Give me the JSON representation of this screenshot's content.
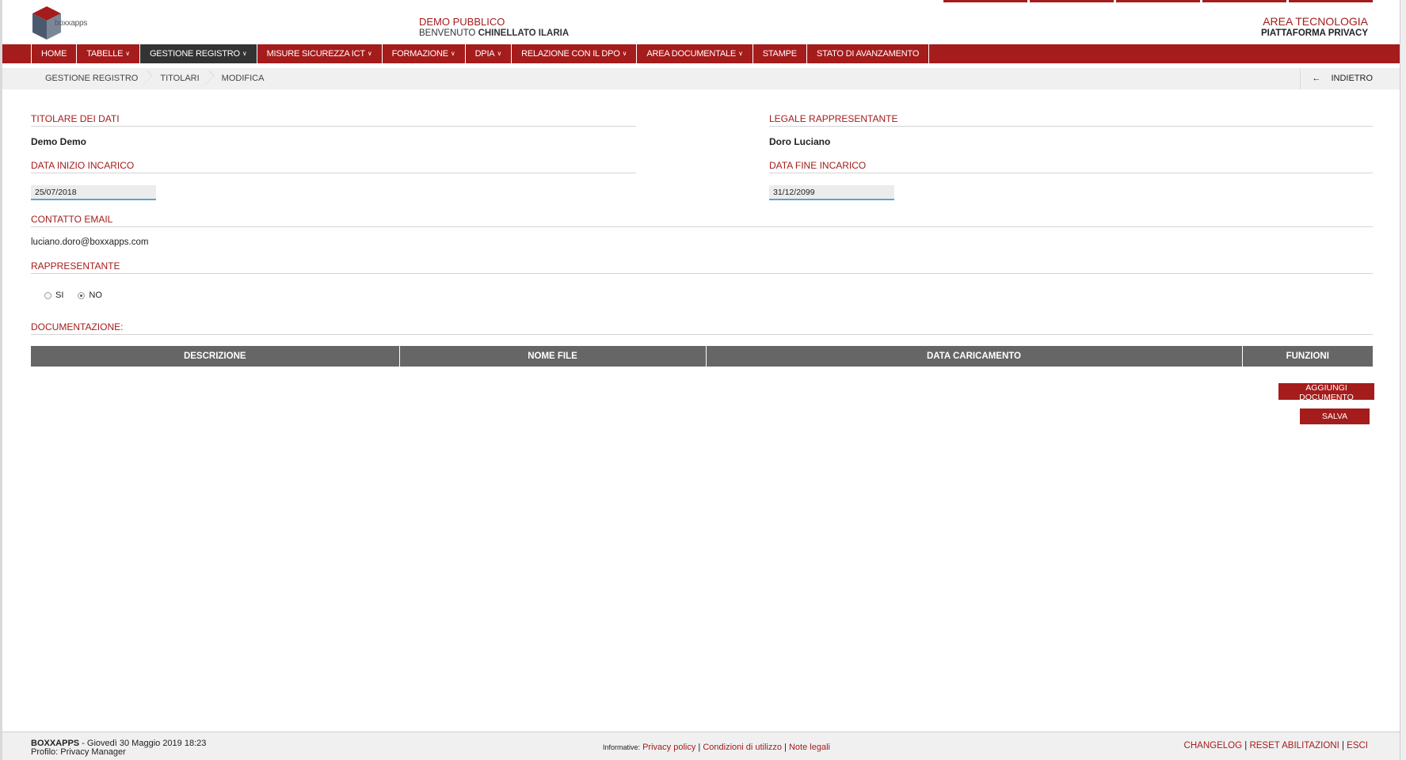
{
  "brand": {
    "logo_label": "boxxapps"
  },
  "header": {
    "demo": "DEMO PUBBLICO",
    "welcome_prefix": "BENVENUTO",
    "user": "CHINELLATO ILARIA",
    "area": "AREA TECNOLOGIA",
    "platform": "PIATTAFORMA PRIVACY"
  },
  "nav": [
    {
      "label": "HOME",
      "dropdown": false
    },
    {
      "label": "TABELLE",
      "dropdown": true
    },
    {
      "label": "GESTIONE REGISTRO",
      "dropdown": true,
      "active": true
    },
    {
      "label": "MISURE SICUREZZA ICT",
      "dropdown": true
    },
    {
      "label": "FORMAZIONE",
      "dropdown": true
    },
    {
      "label": "DPIA",
      "dropdown": true
    },
    {
      "label": "RELAZIONE CON IL DPO",
      "dropdown": true
    },
    {
      "label": "AREA DOCUMENTALE",
      "dropdown": true
    },
    {
      "label": "STAMPE",
      "dropdown": false
    },
    {
      "label": "STATO DI AVANZAMENTO",
      "dropdown": false
    }
  ],
  "breadcrumb": [
    "GESTIONE REGISTRO",
    "TITOLARI",
    "MODIFICA"
  ],
  "back_label": "INDIETRO",
  "form": {
    "titolare_label": "TITOLARE DEI DATI",
    "titolare_value": "Demo Demo",
    "legale_label": "LEGALE RAPPRESENTANTE",
    "legale_value": "Doro Luciano",
    "data_inizio_label": "DATA INIZIO INCARICO",
    "data_inizio_value": "25/07/2018",
    "data_fine_label": "DATA FINE INCARICO",
    "data_fine_value": "31/12/2099",
    "email_label": "CONTATTO EMAIL",
    "email_value": "luciano.doro@boxxapps.com",
    "rappresentante_label": "RAPPRESENTANTE",
    "radio_si": "SI",
    "radio_no": "NO",
    "documentazione_label": "DOCUMENTAZIONE:"
  },
  "table": {
    "headers": [
      "DESCRIZIONE",
      "NOME FILE",
      "DATA CARICAMENTO",
      "FUNZIONI"
    ]
  },
  "buttons": {
    "add_document": "AGGIUNGI DOCUMENTO",
    "save": "SALVA"
  },
  "footer": {
    "brand": "BOXXAPPS",
    "date": "- Giovedì 30 Maggio 2019 18:23",
    "profile": "Profilo: Privacy Manager",
    "info_label": "Informative:",
    "privacy": "Privacy policy",
    "conditions": "Condizioni di utilizzo",
    "legal": "Note legali",
    "changelog": "CHANGELOG",
    "reset": "RESET ABILITAZIONI",
    "exit": "ESCI"
  },
  "colors": {
    "accent": "#a51c1c",
    "nav_active": "#333333",
    "table_header": "#666666"
  }
}
